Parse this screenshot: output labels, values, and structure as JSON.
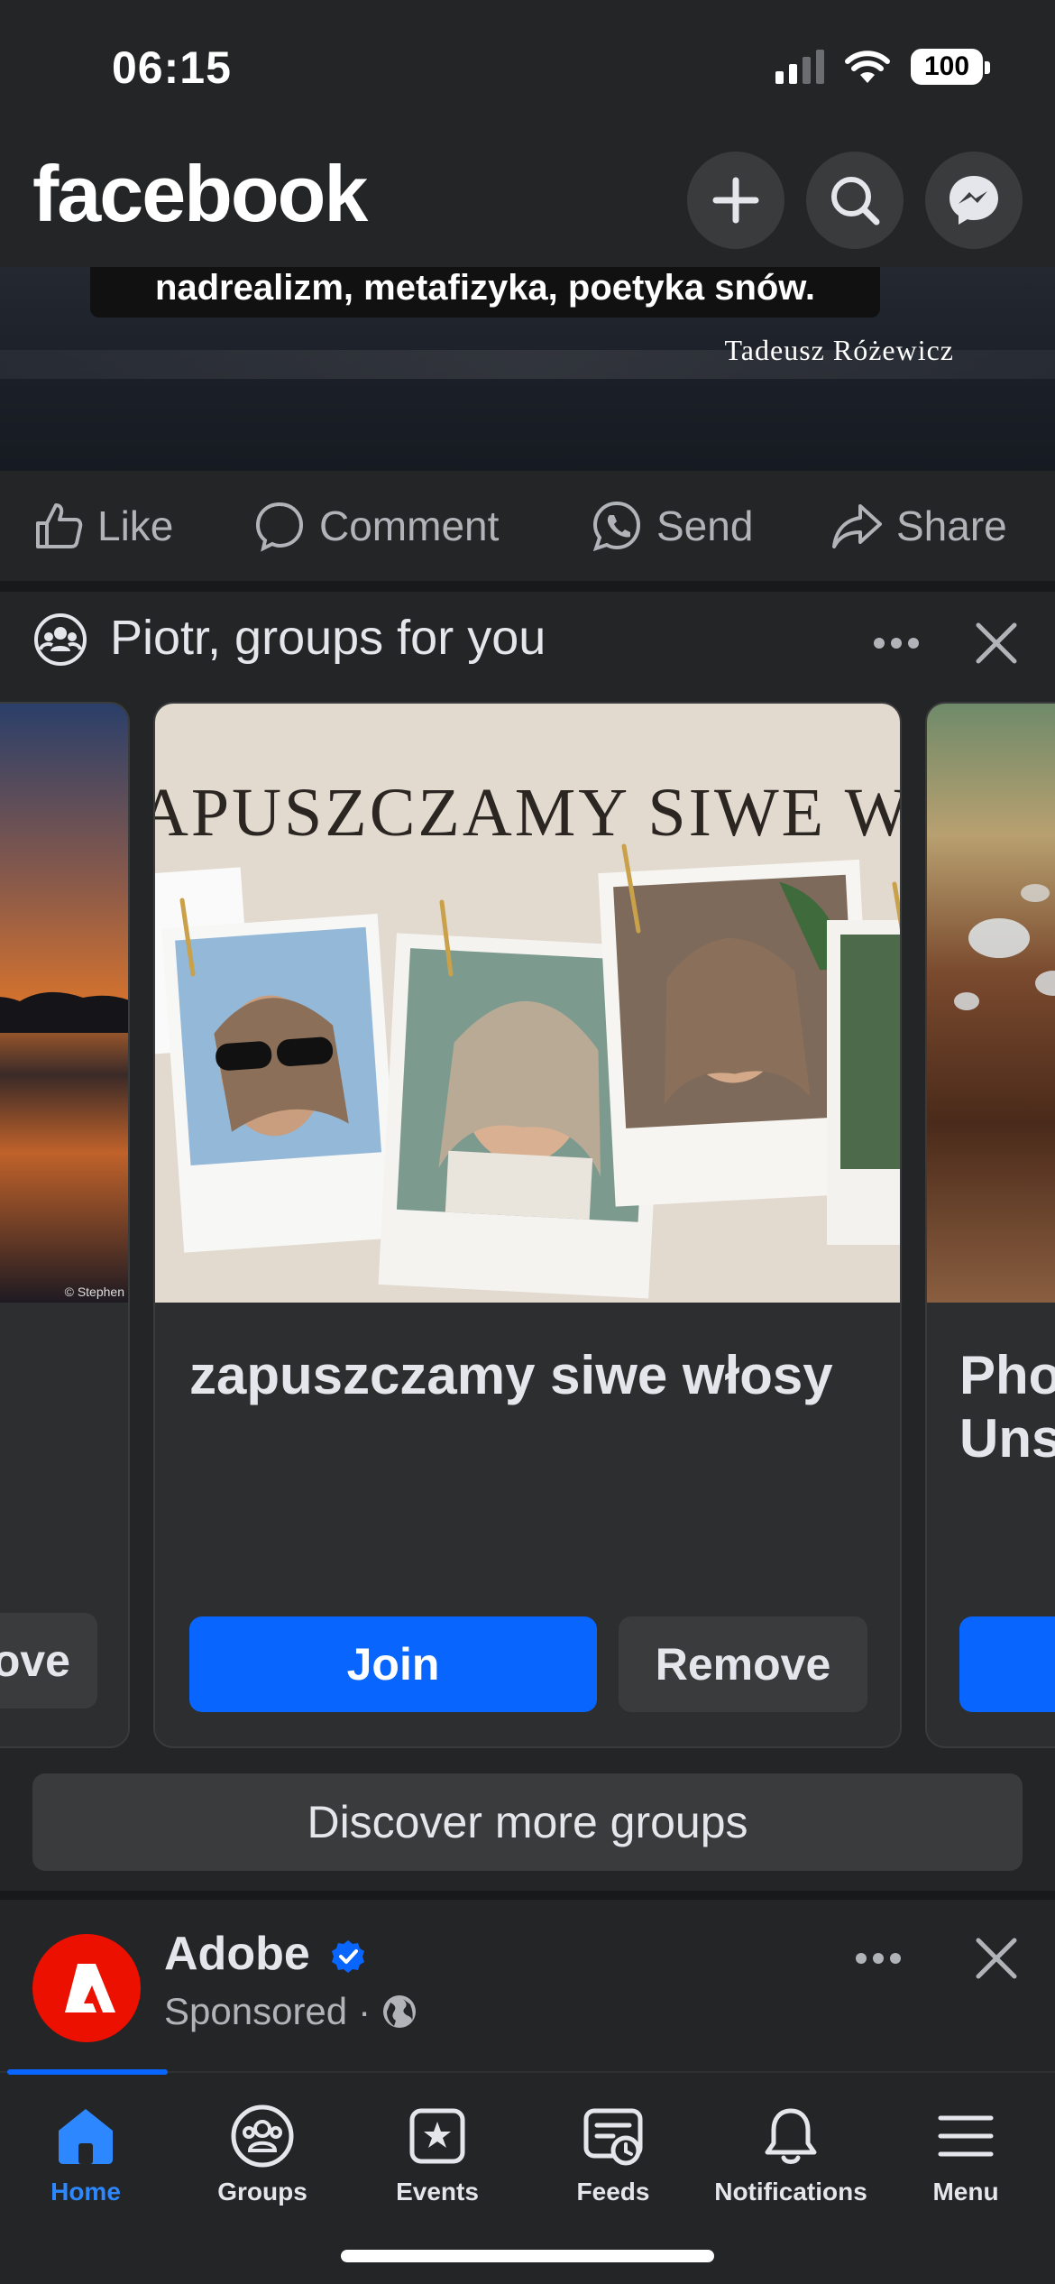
{
  "status_bar": {
    "time": "06:15",
    "battery": "100"
  },
  "header": {
    "logo": "facebook",
    "icons": [
      "plus-icon",
      "search-icon",
      "messenger-icon"
    ]
  },
  "post": {
    "quote": "nadrealizm, metafizyka, poetyka snów.",
    "author": "Tadeusz Różewicz",
    "actions": [
      {
        "label": "Like",
        "icon": "like-icon"
      },
      {
        "label": "Comment",
        "icon": "comment-icon"
      },
      {
        "label": "Send",
        "icon": "send-icon"
      },
      {
        "label": "Share",
        "icon": "share-icon"
      }
    ]
  },
  "groups": {
    "title": "Piotr, groups for you",
    "prev_card": {
      "remove_partial": "ove",
      "credit": "© Stephen"
    },
    "card": {
      "banner_text": "APUSZCZAMY SIWE WŁ",
      "name": "zapuszczamy siwe włosy",
      "join_label": "Join",
      "remove_label": "Remove"
    },
    "next_card": {
      "name_line1": "Pho",
      "name_line2": "Uns"
    },
    "discover_label": "Discover more groups"
  },
  "ad": {
    "name": "Adobe",
    "sponsored": "Sponsored",
    "dot": "·"
  },
  "bottom_nav": {
    "items": [
      {
        "label": "Home",
        "icon": "home-icon",
        "active": true
      },
      {
        "label": "Groups",
        "icon": "groups-icon"
      },
      {
        "label": "Events",
        "icon": "events-icon"
      },
      {
        "label": "Feeds",
        "icon": "feeds-icon"
      },
      {
        "label": "Notifications",
        "icon": "bell-icon"
      },
      {
        "label": "Menu",
        "icon": "menu-icon"
      }
    ]
  },
  "colors": {
    "accent": "#0866ff",
    "background": "#242526",
    "adobe_red": "#eb1000"
  }
}
